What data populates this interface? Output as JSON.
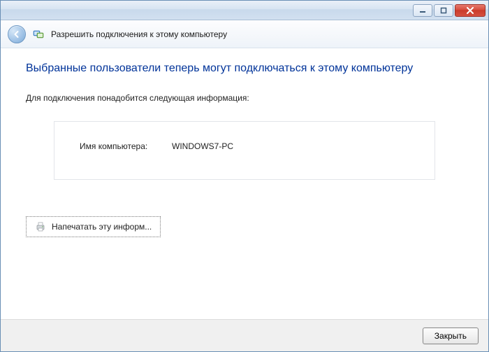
{
  "window": {
    "title": "Разрешить подключения к этому компьютеру"
  },
  "content": {
    "heading": "Выбранные пользователи теперь могут подключаться к этому компьютеру",
    "instruction": "Для подключения понадобится следующая информация:",
    "computer_name_label": "Имя компьютера:",
    "computer_name_value": "WINDOWS7-PC",
    "print_button_label": "Напечатать эту информ..."
  },
  "footer": {
    "close_label": "Закрыть"
  }
}
